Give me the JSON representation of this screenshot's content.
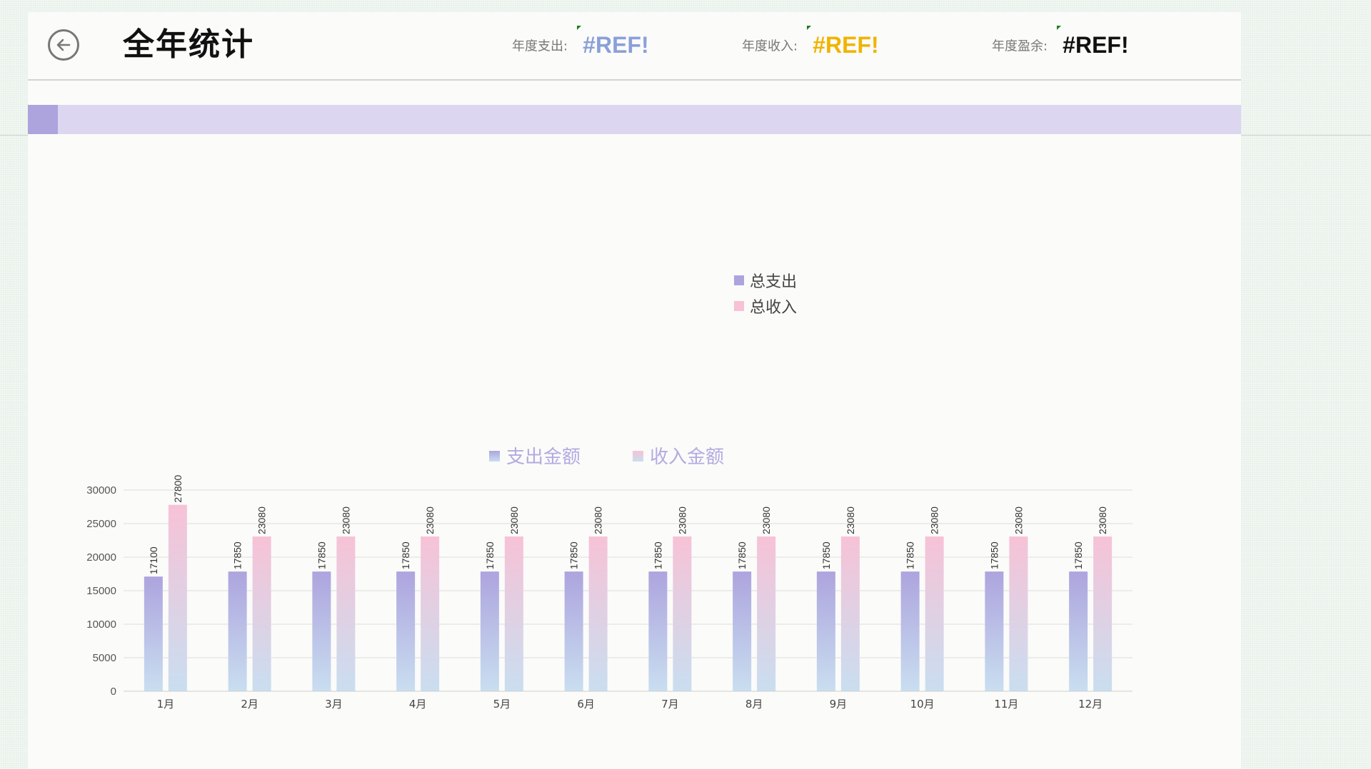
{
  "header": {
    "title": "全年统计",
    "stats": [
      {
        "label": "年度支出:",
        "value": "#REF!",
        "color": "#8aa0d8"
      },
      {
        "label": "年度收入:",
        "value": "#REF!",
        "color": "#f0b400"
      },
      {
        "label": "年度盈余:",
        "value": "#REF!",
        "color": "#111111"
      }
    ]
  },
  "colors": {
    "band": "#dcd6f0",
    "band_accent": "#ada4de",
    "expense": "#ada4de",
    "income": "#f7c2d6",
    "bar_bottom": "#c9def0"
  },
  "legend_summary": [
    {
      "label": "总支出",
      "color": "#ada4de"
    },
    {
      "label": "总收入",
      "color": "#f7c2d6"
    }
  ],
  "chart_data": {
    "type": "bar",
    "title": "",
    "xlabel": "",
    "ylabel": "",
    "legend_position": "top",
    "grid": true,
    "categories": [
      "1月",
      "2月",
      "3月",
      "4月",
      "5月",
      "6月",
      "7月",
      "8月",
      "9月",
      "10月",
      "11月",
      "12月"
    ],
    "yticks": [
      "0",
      "5000",
      "10000",
      "15000",
      "20000",
      "25000",
      "30000"
    ],
    "ylim": [
      0,
      30000
    ],
    "series": [
      {
        "name": "支出金额",
        "values": [
          17100,
          17850,
          17850,
          17850,
          17850,
          17850,
          17850,
          17850,
          17850,
          17850,
          17850,
          17850
        ]
      },
      {
        "name": "收入金额",
        "values": [
          27800,
          23080,
          23080,
          23080,
          23080,
          23080,
          23080,
          23080,
          23080,
          23080,
          23080,
          23080
        ]
      }
    ]
  }
}
